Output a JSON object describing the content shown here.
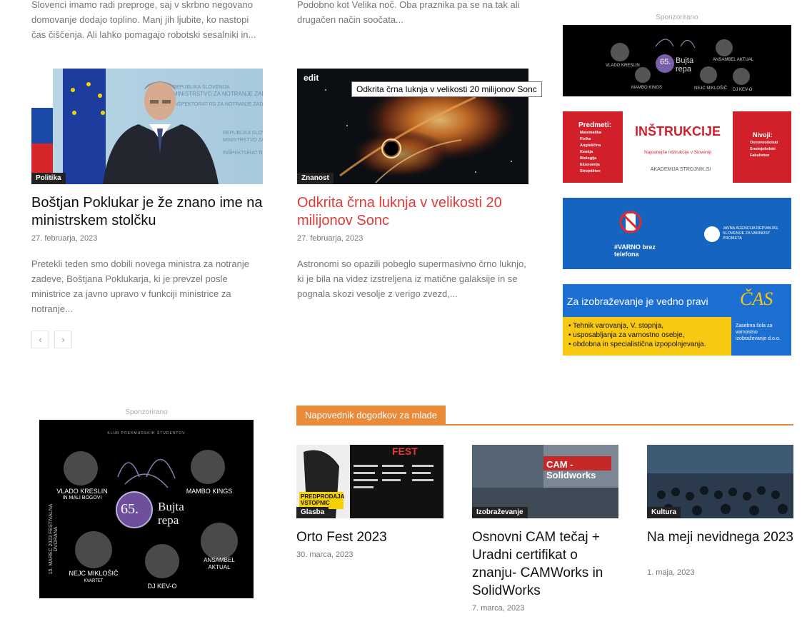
{
  "top_excerpts": {
    "left": "Slovenci imamo radi preproge, saj v skrbno negovano domovanje dodajo toplino. Manj jih ljubite, ko nastopi čas čiščenja. Ali lahko pomagajo robotski sesalniki in...",
    "middle": "Podobno kot Velika noč. Oba praznika pa se na tak ali drugačen način soočata..."
  },
  "articles": [
    {
      "category": "Politika",
      "title": "Boštjan Poklukar je že znano ime na ministrskem stolčku",
      "date": "27. februarja, 2023",
      "excerpt": "Pretekli teden smo dobili novega ministra za notranje zadeve, Boštjana Poklukarja, ki je prevzel posle ministrice za javno upravo v funkciji ministrice za notranje...",
      "image_text": [
        "REPUBLIKA SLOVENIJA",
        "MINISTRSTVO ZA NOTRANJE ZADEVE",
        "INŠPEKTORAT RS ZA NOTRANJE ZADEVE"
      ]
    },
    {
      "category": "Znanost",
      "title": "Odkrita črna luknja v velikosti 20 milijonov Sonc",
      "date": "27. februarja, 2023",
      "excerpt": "Astronomi so opazili pobeglo supermasivno črno luknjo, ki je bila na videz izstreljena iz matične galaksije in se pognala skozi vesolje z verigo zvezd,...",
      "edit_label": "edit",
      "tooltip": "Odkrita črna luknja v velikosti 20 milijonov Sonc"
    }
  ],
  "pager": {
    "prev": "‹",
    "next": "›"
  },
  "sidebar": {
    "sponsor_label": "Sponzorirano",
    "ad_bujta": {
      "number": "65.",
      "name": "Bujta repa",
      "artists": [
        "VLADO KRESLIN",
        "MAMBO KINGS",
        "ANSAMBEL AKTUAL",
        "NEJC MIKLOŠIČ",
        "DJ KEV-O"
      ]
    },
    "ad_instrukcije": {
      "left_title": "Predmeti:",
      "left_items": [
        "Matematika",
        "Fizika",
        "Angleščina",
        "Kemija",
        "Biologija",
        "Ekonomija",
        "Strojništvo"
      ],
      "title": "INŠTRUKCIJE",
      "subtitle": "Najcenejše inštrukcije v Sloveniji",
      "brand": "AKADEMIJA STROJNIK.SI",
      "right_title": "Nivoji:",
      "right_items": [
        "Osnovnošolski",
        "Srednješolski",
        "Fakulteten"
      ]
    },
    "ad_varno": {
      "slogan": "#VARNO brez telefona",
      "agency": "JAVNA AGENCIJA REPUBLIKE SLOVENIJE ZA VARNOST PROMETA"
    },
    "ad_cas": {
      "headline": "Za izobraževanje je vedno pravi",
      "logo": "ČAS",
      "bullets": [
        "Tehnik varovanja, V. stopnja,",
        "usposabljanja za varnostno osebje,",
        "obdobna in specialistična izpopolnjevanja."
      ],
      "school": "Zasebna šola za varnostno izobraževanje d.o.o."
    }
  },
  "bottom_left": {
    "sponsor_label": "Sponzorirano",
    "poster": {
      "header": "KLUB PREKMURSKIH ŠTUDENTOV",
      "number": "65.",
      "name": "Bujta repa",
      "date": "15. MAREC 2023 FESTIVALNA DVORANA",
      "artists": [
        {
          "name": "VLADO KRESLIN",
          "sub": "IN MALI BOGOVI"
        },
        {
          "name": "MAMBO KINGS",
          "sub": ""
        },
        {
          "name": "NEJC MIKLOŠIČ",
          "sub": "KVARTET"
        },
        {
          "name": "ANSAMBEL",
          "sub": "AKTUAL"
        },
        {
          "name": "DJ KEV-O",
          "sub": ""
        }
      ]
    }
  },
  "events_block": {
    "heading": "Napovednik dogodkov za mlade",
    "items": [
      {
        "category": "Glasba",
        "title": "Orto Fest 2023",
        "date": "30. marca, 2023",
        "img_label": "PREDPRODAJA VSTOPNIC",
        "img_brand": "FEST"
      },
      {
        "category": "Izobraževanje",
        "title": "Osnovni CAM tečaj + Uradni certifikat o znanju- CAMWorks in SolidWorks",
        "date": "7. marca, 2023",
        "img_label": "CAM - Solidworks"
      },
      {
        "category": "Kultura",
        "title": "Na meji nevidnega 2023",
        "date": "1. maja, 2023"
      }
    ]
  },
  "colors": {
    "accent": "#e98b38",
    "link_red": "#e03a3a",
    "ad_red": "#d2202b",
    "ad_blue": "#1565c0",
    "ad_yellow": "#f8c812"
  }
}
